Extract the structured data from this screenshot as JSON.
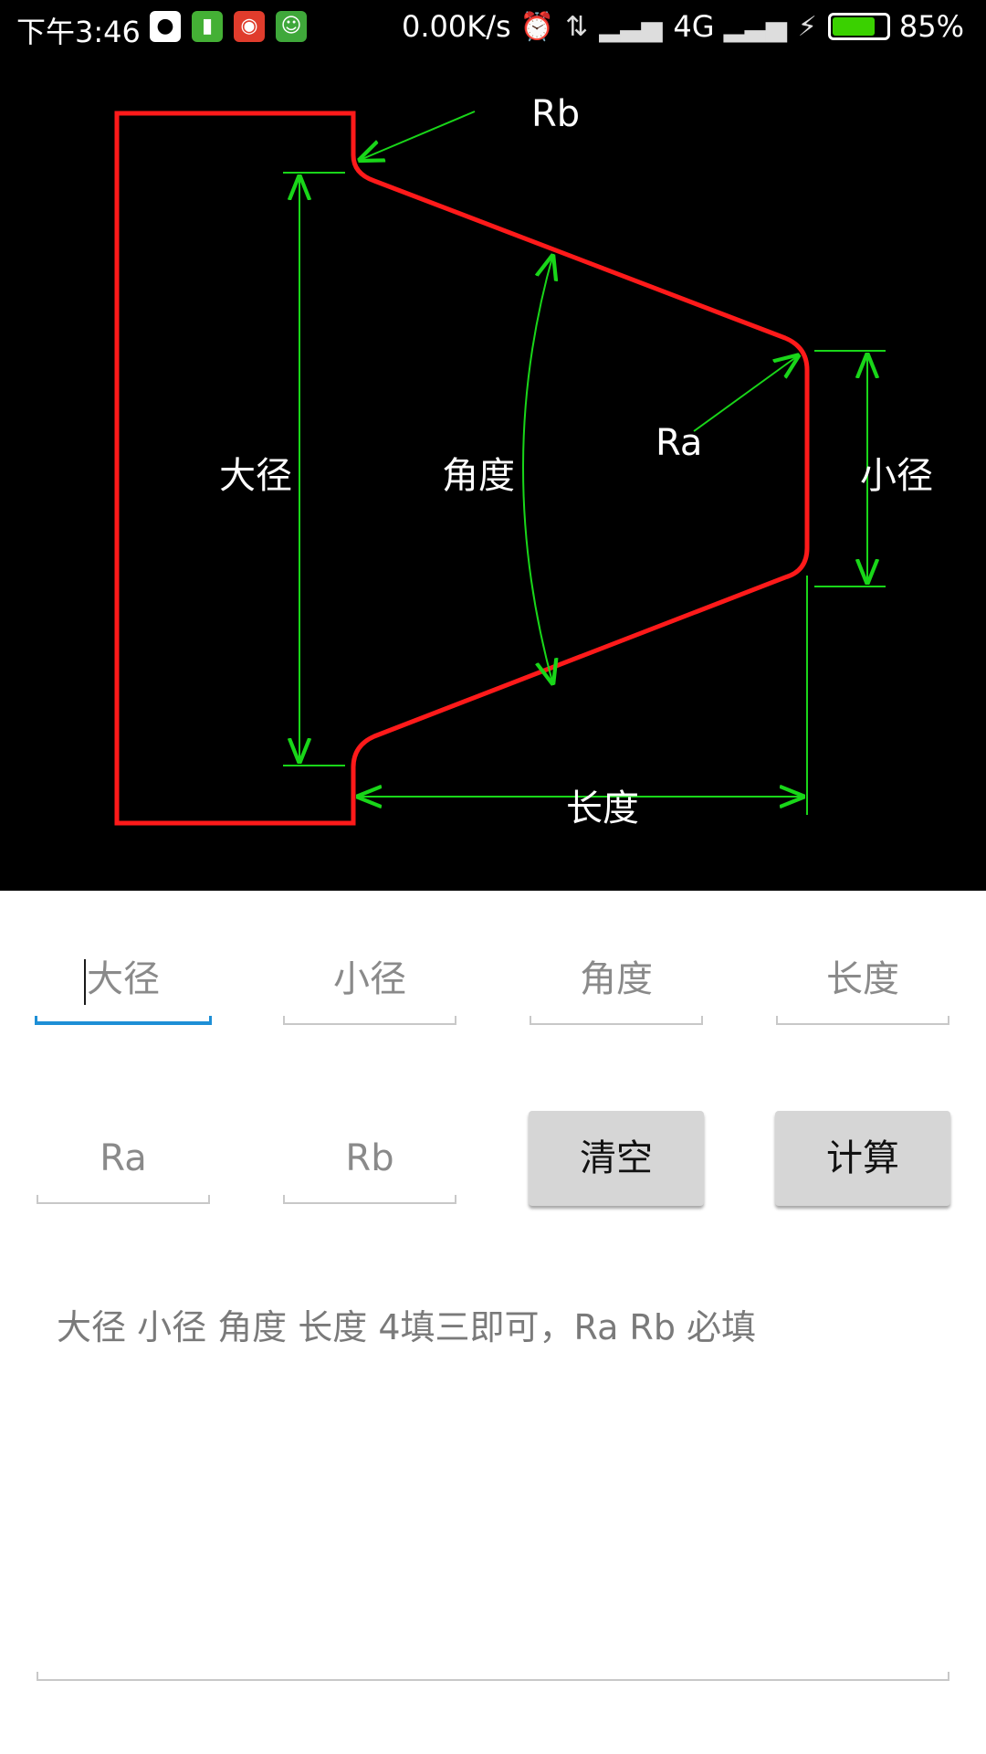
{
  "status_bar": {
    "time": "下午3:46",
    "net_speed": "0.00K/s",
    "network": "4G",
    "battery": "85%",
    "battery_level": 0.85,
    "icons": [
      "qq-icon",
      "battery-app-icon",
      "bull-app-icon",
      "robot-app-icon",
      "alarm-icon",
      "data-icon",
      "signal-icon",
      "signal2-icon",
      "charging-icon"
    ]
  },
  "diagram": {
    "labels": {
      "big_diameter": "大径",
      "small_diameter": "小径",
      "angle": "角度",
      "length": "长度",
      "ra": "Ra",
      "rb": "Rb"
    },
    "colors": {
      "outline": "#ff1a1a",
      "dimension": "#19d619",
      "background": "#000000"
    }
  },
  "form": {
    "big_diameter_placeholder": "大径",
    "small_diameter_placeholder": "小径",
    "angle_placeholder": "角度",
    "length_placeholder": "长度",
    "ra_placeholder": "Ra",
    "rb_placeholder": "Rb",
    "clear_label": "清空",
    "calc_label": "计算",
    "focus_color": "#1e8fd6"
  },
  "hint_text": "大径 小径 角度 长度 4填三即可，Ra Rb 必填"
}
